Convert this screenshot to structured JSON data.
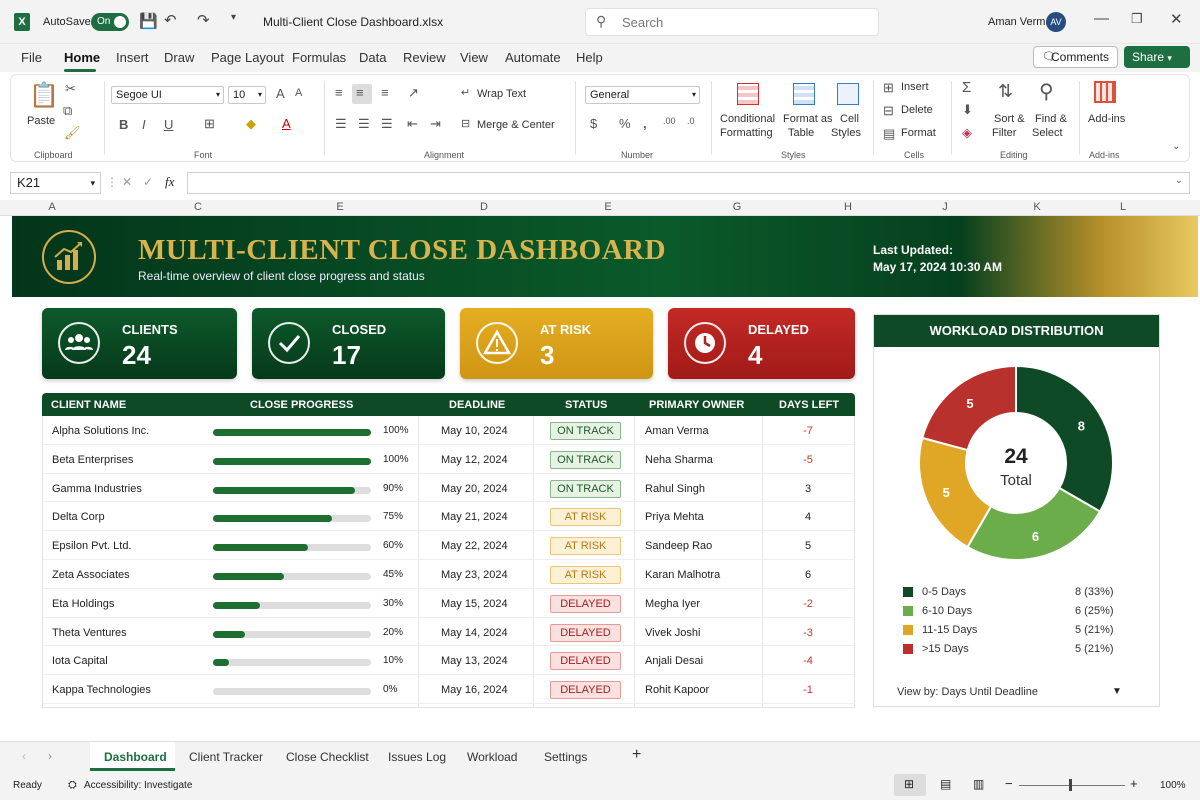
{
  "titlebar": {
    "autosave": "AutoSave",
    "toggle": "On",
    "filename": "Multi-Client Close Dashboard.xlsx",
    "search": "Search",
    "user": "Aman Verma",
    "initials": "AV"
  },
  "menu": [
    "File",
    "Home",
    "Insert",
    "Draw",
    "Page Layout",
    "Formulas",
    "Data",
    "Review",
    "View",
    "Automate",
    "Help"
  ],
  "menu_buttons": {
    "comments": "Comments",
    "share": "Share"
  },
  "ribbon": {
    "paste": "Paste",
    "font_name": "Segoe UI",
    "font_size": "10",
    "wrap": "Wrap Text",
    "merge": "Merge & Center",
    "number_format": "General",
    "cond": [
      "Conditional",
      "Formatting"
    ],
    "fmt_table": [
      "Format as",
      "Table"
    ],
    "cell_styles": [
      "Cell",
      "Styles"
    ],
    "insert": "Insert",
    "delete": "Delete",
    "format": "Format",
    "sort": [
      "Sort &",
      "Filter"
    ],
    "find": [
      "Find &",
      "Select"
    ],
    "addins": "Add-ins",
    "groups": [
      "Clipboard",
      "Font",
      "Alignment",
      "Number",
      "Styles",
      "Cells",
      "Editing",
      "Add-ins"
    ]
  },
  "namebox": "K21",
  "fx": "fx",
  "columns": [
    "A",
    "C",
    "E",
    "D",
    "E",
    "G",
    "H",
    "J",
    "K",
    "L"
  ],
  "banner": {
    "title": "MULTI-CLIENT CLOSE DASHBOARD",
    "subtitle": "Real-time overview of client close progress and status",
    "updated_label": "Last Updated:",
    "updated_value": "May 17, 2024 10:30 AM"
  },
  "kpis": [
    {
      "label": "CLIENTS",
      "value": "24",
      "color": "#0d4d25"
    },
    {
      "label": "CLOSED",
      "value": "17",
      "color": "#0d4d25"
    },
    {
      "label": "AT RISK",
      "value": "3",
      "color": "#d9a21c"
    },
    {
      "label": "DELAYED",
      "value": "4",
      "color": "#b3201f"
    }
  ],
  "table": {
    "headers": [
      "CLIENT NAME",
      "CLOSE PROGRESS",
      "DEADLINE",
      "STATUS",
      "PRIMARY OWNER",
      "DAYS LEFT"
    ],
    "rows": [
      {
        "client": "Alpha Solutions Inc.",
        "progress": 100,
        "progress_label": "100%",
        "deadline": "May 10, 2024",
        "status": "ON TRACK",
        "owner": "Aman Verma",
        "days": "-7"
      },
      {
        "client": "Beta Enterprises",
        "progress": 100,
        "progress_label": "100%",
        "deadline": "May 12, 2024",
        "status": "ON TRACK",
        "owner": "Neha Sharma",
        "days": "-5"
      },
      {
        "client": "Gamma Industries",
        "progress": 90,
        "progress_label": "90%",
        "deadline": "May 20, 2024",
        "status": "ON TRACK",
        "owner": "Rahul Singh",
        "days": "3"
      },
      {
        "client": "Delta Corp",
        "progress": 75,
        "progress_label": "75%",
        "deadline": "May 21, 2024",
        "status": "AT RISK",
        "owner": "Priya Mehta",
        "days": "4"
      },
      {
        "client": "Epsilon Pvt. Ltd.",
        "progress": 60,
        "progress_label": "60%",
        "deadline": "May 22, 2024",
        "status": "AT RISK",
        "owner": "Sandeep Rao",
        "days": "5"
      },
      {
        "client": "Zeta Associates",
        "progress": 45,
        "progress_label": "45%",
        "deadline": "May 23, 2024",
        "status": "AT RISK",
        "owner": "Karan Malhotra",
        "days": "6"
      },
      {
        "client": "Eta Holdings",
        "progress": 30,
        "progress_label": "30%",
        "deadline": "May 15, 2024",
        "status": "DELAYED",
        "owner": "Megha Iyer",
        "days": "-2"
      },
      {
        "client": "Theta Ventures",
        "progress": 20,
        "progress_label": "20%",
        "deadline": "May 14, 2024",
        "status": "DELAYED",
        "owner": "Vivek Joshi",
        "days": "-3"
      },
      {
        "client": "Iota Capital",
        "progress": 10,
        "progress_label": "10%",
        "deadline": "May 13, 2024",
        "status": "DELAYED",
        "owner": "Anjali Desai",
        "days": "-4"
      },
      {
        "client": "Kappa Technologies",
        "progress": 0,
        "progress_label": "0%",
        "deadline": "May 16, 2024",
        "status": "DELAYED",
        "owner": "Rohit Kapoor",
        "days": "-1"
      }
    ]
  },
  "workload": {
    "title": "WORKLOAD DISTRIBUTION",
    "total": "24",
    "total_label": "Total",
    "segments": [
      {
        "label": "0-5 Days",
        "value": 8,
        "display": "8 (33%)",
        "color": "#0f4a26"
      },
      {
        "label": "6-10 Days",
        "value": 6,
        "display": "6 (25%)",
        "color": "#6aad4a"
      },
      {
        "label": "11-15 Days",
        "value": 5,
        "display": "5 (21%)",
        "color": "#e0a626"
      },
      {
        "label": ">15 Days",
        "value": 5,
        "display": "5 (21%)",
        "color": "#b8312c"
      }
    ],
    "viewby_label": "View by:",
    "viewby": "Days Until Deadline"
  },
  "sheets": [
    "Dashboard",
    "Client Tracker",
    "Close Checklist",
    "Issues Log",
    "Workload",
    "Settings"
  ],
  "status": {
    "ready": "Ready",
    "accessibility": "Accessibility: Investigate",
    "zoom": "100%"
  }
}
